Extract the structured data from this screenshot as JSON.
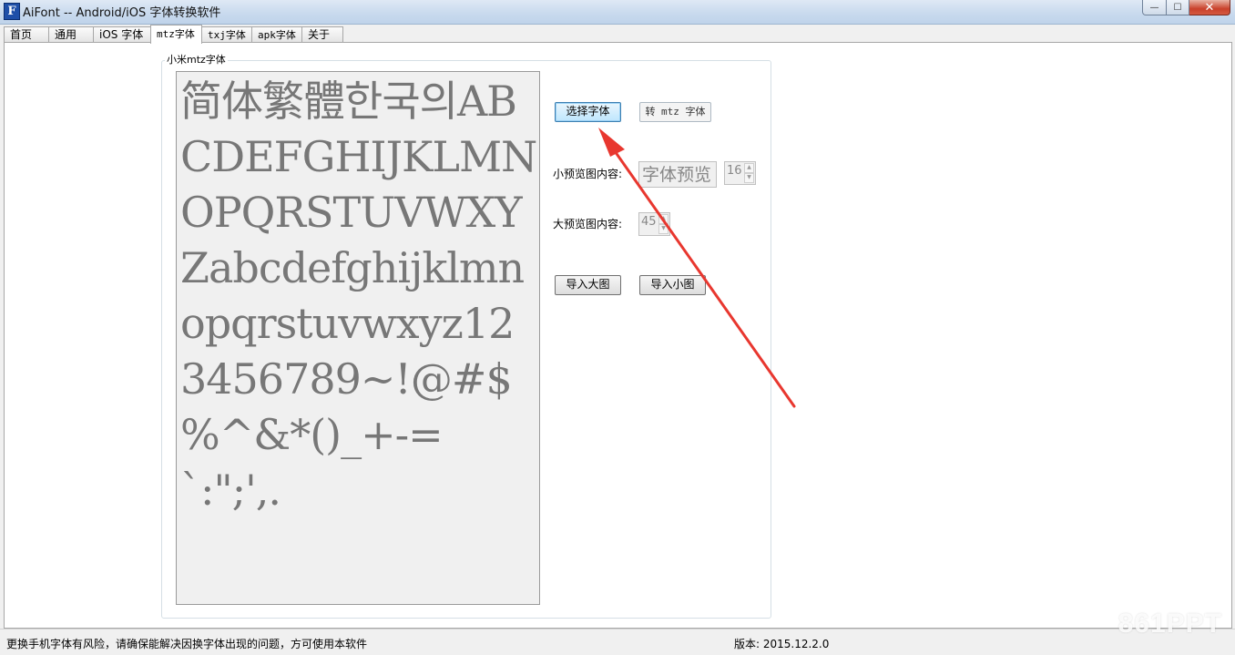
{
  "window": {
    "title": "AiFont -- Android/iOS 字体转换软件",
    "icon_letter": "F",
    "minimize_glyph": "—",
    "maximize_glyph": "☐",
    "close_glyph": "✕"
  },
  "tabs": [
    {
      "label": "首页"
    },
    {
      "label": "通用"
    },
    {
      "label": "iOS 字体"
    },
    {
      "label": "mtz字体",
      "active": true
    },
    {
      "label": "txj字体"
    },
    {
      "label": "apk字体"
    },
    {
      "label": "关于"
    }
  ],
  "group": {
    "title": "小米mtz字体",
    "preview_text": "简体繁體한국의ABCDEFGHIJKLMNOPQRSTUVWXYZabcdefghijklmnopqrstuvwxyz123456789~!@#$%^&*()_+-=`:\";',."
  },
  "controls": {
    "choose_font_label": "选择字体",
    "convert_mtz_label": "转 mtz 字体",
    "small_preview_label": "小预览图内容:",
    "small_preview_value": "字体预览",
    "small_preview_size": "16",
    "large_preview_label": "大预览图内容:",
    "large_preview_size": "45",
    "import_large_label": "导入大图",
    "import_small_label": "导入小图"
  },
  "status": {
    "warning": "更换手机字体有风险，请确保能解决因换字体出现的问题，方可使用本软件",
    "version": "版本: 2015.12.2.0"
  },
  "watermark": "861PPT",
  "colors": {
    "annotation_arrow": "#e8372f",
    "focused_button": "#3c7fb1"
  }
}
